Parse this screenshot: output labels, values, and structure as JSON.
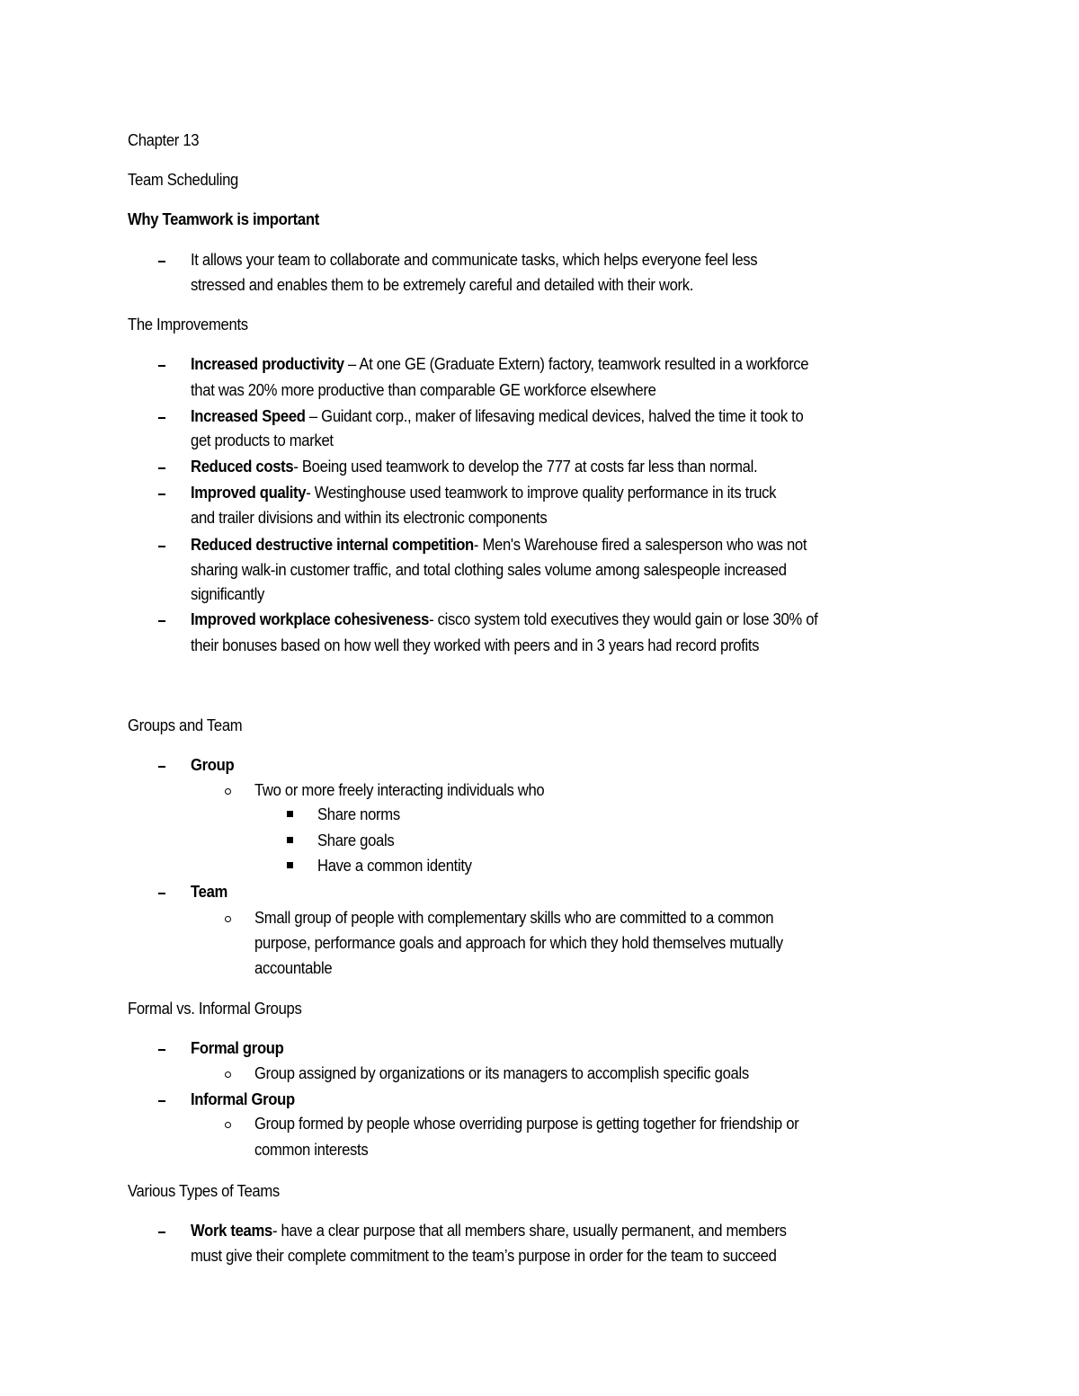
{
  "document": {
    "chapter": "Chapter 13",
    "subtitle": "Team Scheduling",
    "why_heading": "Why Teamwork is important",
    "why_items": [
      {
        "lines": [
          "It allows your team to collaborate and communicate tasks, which helps everyone feel less",
          "stressed and enables them to be extremely careful and detailed with their work."
        ]
      }
    ],
    "improvements_heading": "The Improvements",
    "improvements": [
      {
        "term": "Increased productivity",
        "line1": " – At one GE (Graduate Extern) factory, teamwork resulted in a workforce",
        "line2": "that was 20% more productive than comparable GE workforce elsewhere"
      },
      {
        "term": "Increased Speed",
        "line1": " – Guidant corp., maker of lifesaving medical devices, halved the time it took to",
        "line2": "get products to market"
      },
      {
        "term": "Reduced costs",
        "line1": "- Boeing used teamwork to develop the 777 at costs far less than normal."
      },
      {
        "term": "Improved quality",
        "line1": "- Westinghouse used teamwork to improve quality performance in its truck",
        "line2": "and trailer divisions and within its electronic components"
      },
      {
        "term": "Reduced destructive internal competition",
        "line1": "- Men's Warehouse fired a salesperson who was not",
        "line2": "sharing walk-in customer traffic, and total clothing sales volume among salespeople increased",
        "line3": "significantly"
      },
      {
        "term": "Improved workplace cohesiveness",
        "line1": "- cisco system told executives they would gain or lose 30% of",
        "line2": "their bonuses based on how well they worked with peers and in 3 years had record profits"
      }
    ],
    "groups_heading": "Groups and Team",
    "group": {
      "term": "Group",
      "definition": "Two or more freely interacting individuals who",
      "traits": [
        "Share norms",
        "Share goals",
        "Have a common identity"
      ]
    },
    "team": {
      "term": "Team",
      "definition_lines": [
        "Small group of people with complementary skills who are committed to a common",
        "purpose, performance goals and approach for which they hold themselves mutually",
        "accountable"
      ]
    },
    "formal_heading": "Formal vs. Informal Groups",
    "formal_group": {
      "term": "Formal group",
      "definition": "Group assigned by organizations or its managers to accomplish specific goals"
    },
    "informal_group": {
      "term": "Informal Group",
      "definition_lines": [
        "Group formed by people whose overriding purpose is getting together for friendship or",
        "common interests"
      ]
    },
    "types_heading": "Various Types of Teams",
    "team_types": [
      {
        "term": "Work teams",
        "line1": "- have a clear purpose that all members share, usually permanent, and members",
        "line2": "must give their complete commitment to the team’s purpose in order for the team to succeed"
      }
    ]
  }
}
